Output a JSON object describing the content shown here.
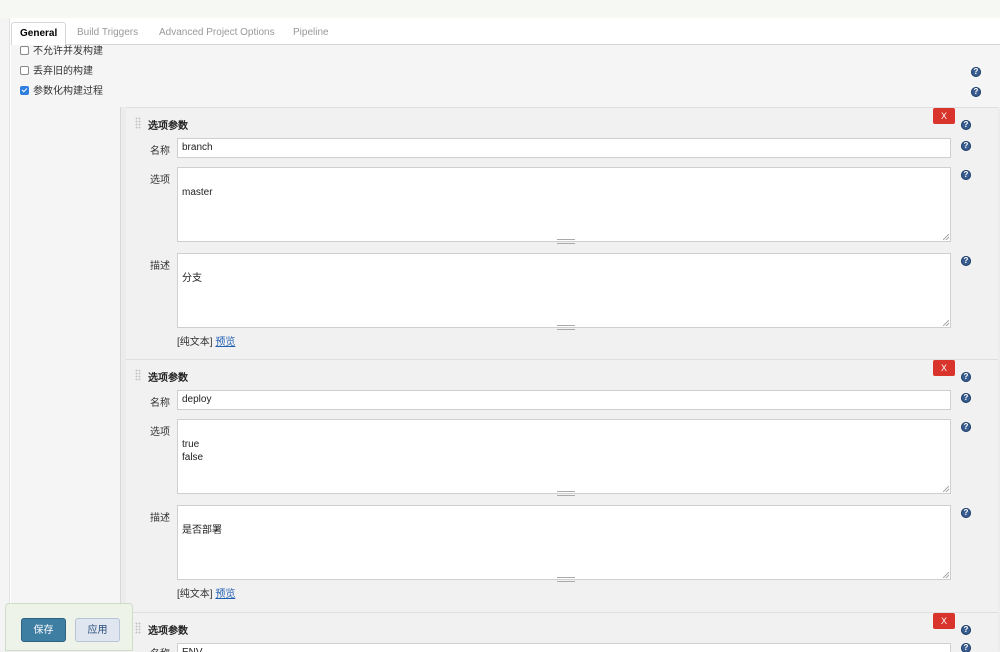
{
  "tabs": [
    {
      "label": "General",
      "active": true
    },
    {
      "label": "Build Triggers",
      "active": false
    },
    {
      "label": "Advanced Project Options",
      "active": false
    },
    {
      "label": "Pipeline",
      "active": false
    }
  ],
  "options": [
    {
      "label": "不允许并发构建",
      "checked": false
    },
    {
      "label": "丢弃旧的构建",
      "checked": false
    },
    {
      "label": "参数化构建过程",
      "checked": true
    }
  ],
  "help_glyph": "?",
  "params": [
    {
      "title": "选项参数",
      "delete_label": "X",
      "name_label": "名称",
      "name_value": "branch",
      "choices_label": "选项",
      "choices_value": "master",
      "desc_label": "描述",
      "desc_value": "分支",
      "plain_text": "[纯文本]",
      "preview": "预览"
    },
    {
      "title": "选项参数",
      "delete_label": "X",
      "name_label": "名称",
      "name_value": "deploy",
      "choices_label": "选项",
      "choices_value": "true\nfalse",
      "desc_label": "描述",
      "desc_value": "是否部署",
      "plain_text": "[纯文本]",
      "preview": "预览"
    },
    {
      "title": "选项参数",
      "delete_label": "X",
      "name_label": "名称",
      "name_value": "ENV"
    }
  ],
  "buttons": {
    "save": "保存",
    "apply": "应用"
  },
  "colors": {
    "delete": "#d9342b",
    "save": "#3e7ea3",
    "help": "#3a5d8f",
    "checked": "#2f7fe0"
  }
}
